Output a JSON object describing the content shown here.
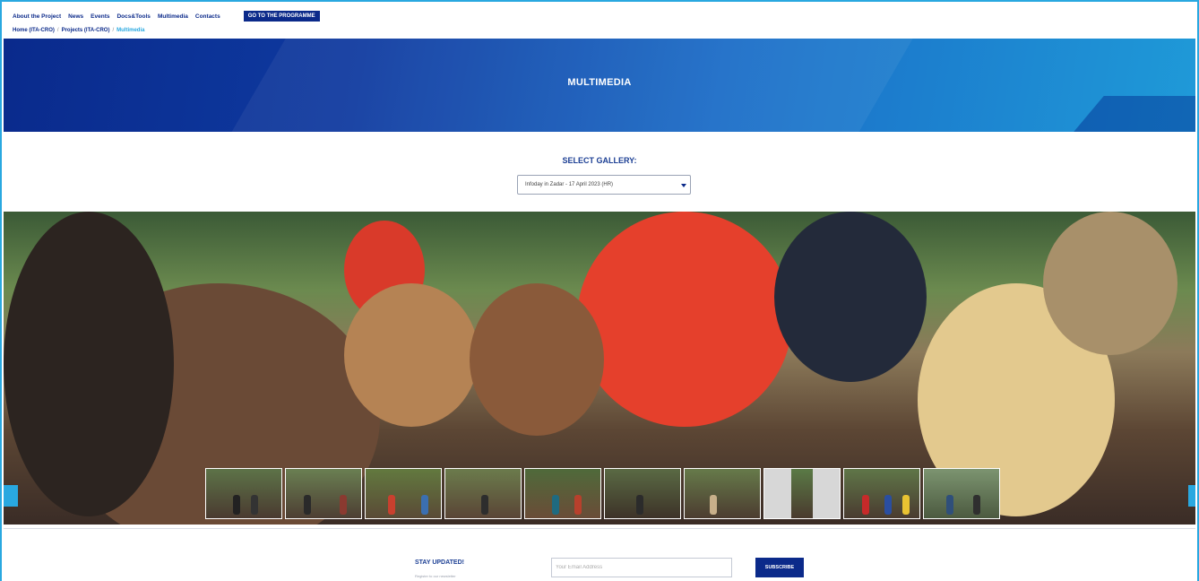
{
  "nav": {
    "items": [
      "About the Project",
      "News",
      "Events",
      "Docs&Tools",
      "Multimedia",
      "Contacts"
    ],
    "program_button": "GO TO THE PROGRAMME"
  },
  "breadcrumb": {
    "home": "Home (ITA-CRO)",
    "separator": "/",
    "projects": "Projects (ITA-CRO)",
    "current": "Multimedia"
  },
  "banner": {
    "title": "MULTIMEDIA"
  },
  "gallery": {
    "label": "SELECT GALLERY:",
    "selected": "Infoday in Zadar - 17 April 2023 (HR)",
    "thumbnail_count": 10
  },
  "newsletter": {
    "title": "STAY UPDATED!",
    "subtitle": "Register to our newsletter",
    "email_placeholder": "Your Email Address",
    "subscribe_label": "SUBSCRIBE"
  },
  "colors": {
    "brand_blue": "#0b2a8a",
    "accent_cyan": "#29a8e0"
  }
}
